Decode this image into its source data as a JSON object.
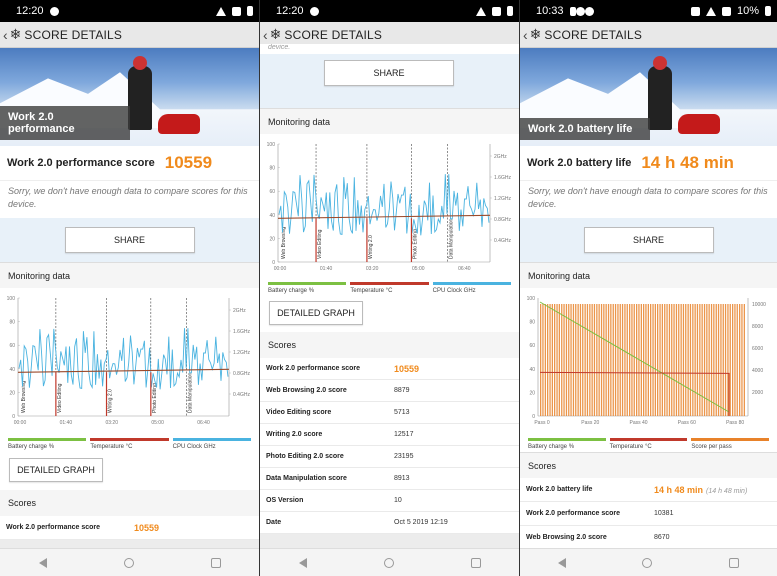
{
  "screens": [
    {
      "status": {
        "time": "12:20"
      },
      "appbar": {
        "title": "SCORE DETAILS"
      },
      "hero": {
        "label": "Work 2.0 performance"
      },
      "score": {
        "label": "Work 2.0 performance score",
        "value": "10559"
      },
      "note": "Sorry, we don't have enough data to compare scores for this device.",
      "share_label": "SHARE",
      "monitoring_title": "Monitoring data",
      "chart": {
        "left_ticks": [
          "100",
          "80",
          "60",
          "40",
          "20",
          "0"
        ],
        "right_ticks": [
          "2GHz",
          "1.6GHz",
          "1.2GHz",
          "0.8GHz",
          "0.4GHz"
        ],
        "x_ticks": [
          "00:00",
          "01:40",
          "03:20",
          "05:00",
          "06:40"
        ],
        "segments": [
          "Web Browsing",
          "Video Editing",
          "Writing 2.0",
          "Photo Editing",
          "Data Manipulation"
        ]
      },
      "legend": [
        "Battery charge %",
        "Temperature °C",
        "CPU Clock GHz"
      ],
      "detailed_label": "DETAILED GRAPH",
      "scores_title": "Scores",
      "rows": [
        {
          "k": "Work 2.0 performance score",
          "v": "10559"
        }
      ]
    },
    {
      "status": {
        "time": "12:20"
      },
      "appbar": {
        "title": "SCORE DETAILS"
      },
      "top_fragment": "device.",
      "share_label": "SHARE",
      "monitoring_title": "Monitoring data",
      "chart": {
        "left_ticks": [
          "100",
          "80",
          "60",
          "40",
          "20",
          "0"
        ],
        "right_ticks": [
          "2GHz",
          "1.6GHz",
          "1.2GHz",
          "0.8GHz",
          "0.4GHz"
        ],
        "x_ticks": [
          "00:00",
          "01:40",
          "03:20",
          "05:00",
          "06:40"
        ],
        "segments": [
          "Web Browsing",
          "Video Editing",
          "Writing 2.0",
          "Photo Editing",
          "Data Manipulation"
        ]
      },
      "legend": [
        "Battery charge %",
        "Temperature °C",
        "CPU Clock GHz"
      ],
      "detailed_label": "DETAILED GRAPH",
      "scores_title": "Scores",
      "rows": [
        {
          "k": "Work 2.0 performance score",
          "v": "10559"
        },
        {
          "k": "Web Browsing 2.0 score",
          "v": "8879"
        },
        {
          "k": "Video Editing score",
          "v": "5713"
        },
        {
          "k": "Writing 2.0 score",
          "v": "12517"
        },
        {
          "k": "Photo Editing 2.0 score",
          "v": "23195"
        },
        {
          "k": "Data Manipulation score",
          "v": "8913"
        },
        {
          "k": "OS Version",
          "v": "10"
        },
        {
          "k": "Date",
          "v": "Oct 5 2019 12:19"
        }
      ]
    },
    {
      "status": {
        "time": "10:33",
        "battery": "10%"
      },
      "appbar": {
        "title": "SCORE DETAILS"
      },
      "hero": {
        "label": "Work 2.0 battery life"
      },
      "score": {
        "label": "Work 2.0 battery life",
        "value": "14 h 48 min"
      },
      "note": "Sorry, we don't have enough data to compare scores for this device.",
      "share_label": "SHARE",
      "monitoring_title": "Monitoring data",
      "chart": {
        "left_ticks": [
          "100",
          "80",
          "60",
          "40",
          "20",
          "0"
        ],
        "right_ticks": [
          "10000",
          "8000",
          "6000",
          "4000",
          "2000"
        ],
        "x_ticks": [
          "Pass 0",
          "Pass 20",
          "Pass 40",
          "Pass 60",
          "Pass 80"
        ]
      },
      "legend": [
        "Battery charge %",
        "Temperature °C",
        "Score per pass"
      ],
      "scores_title": "Scores",
      "rows": [
        {
          "k": "Work 2.0 battery life",
          "v": "14 h 48 min",
          "sub": "(14 h 48 min)"
        },
        {
          "k": "Work 2.0 performance score",
          "v": "10381"
        },
        {
          "k": "Web Browsing 2.0 score",
          "v": "8670"
        }
      ]
    }
  ],
  "colors": {
    "accent": "#f08a1c",
    "battery": "#7cc042",
    "temperature": "#c0392b",
    "cpu": "#4ab3e0",
    "pass": "#e8822a"
  }
}
